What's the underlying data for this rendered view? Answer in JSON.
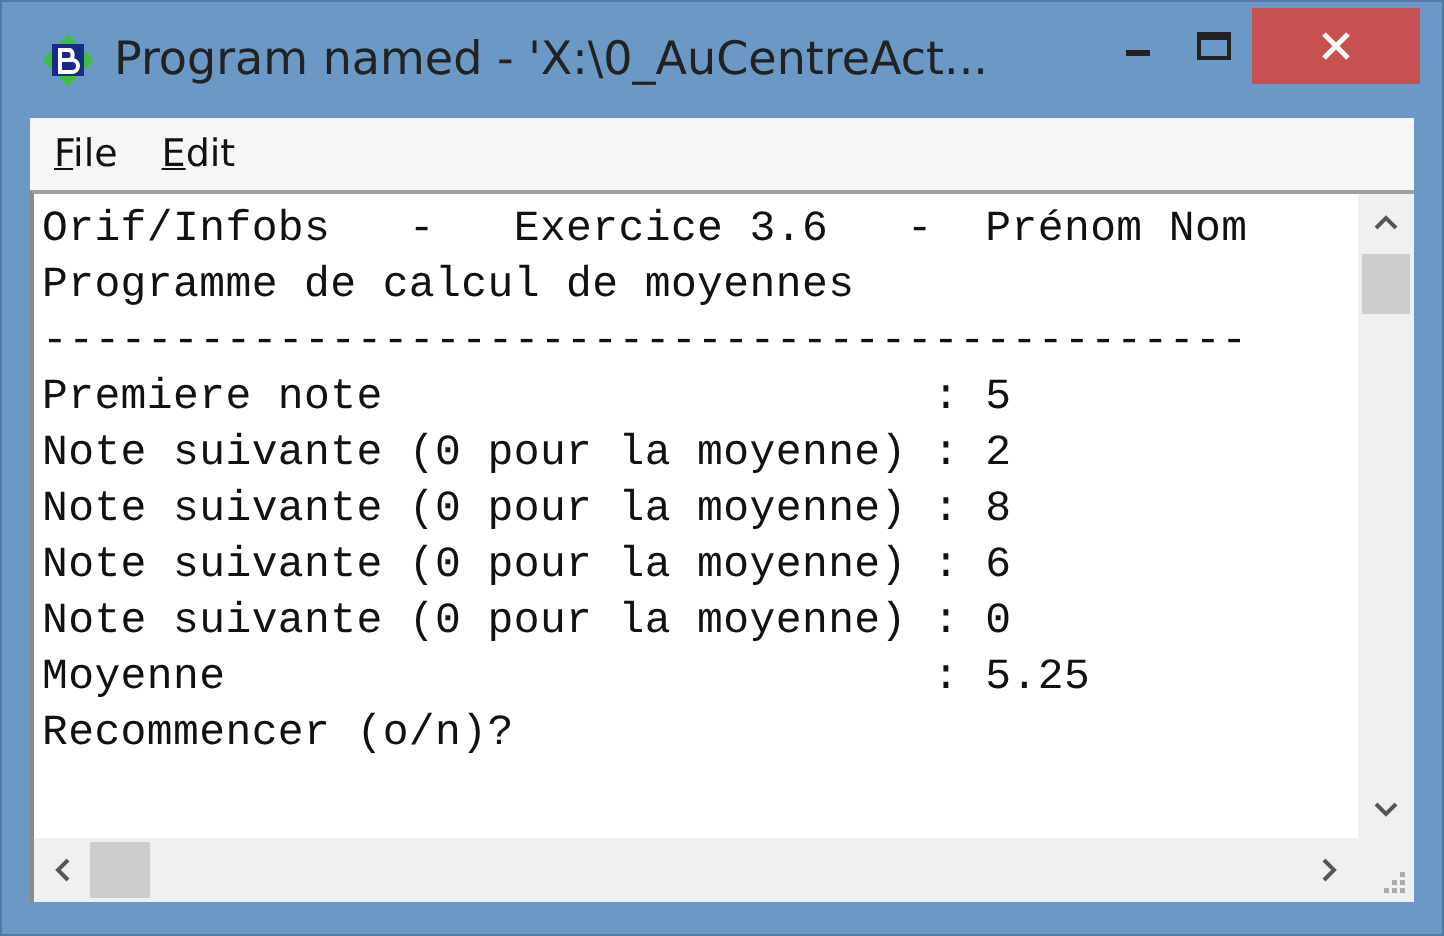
{
  "window": {
    "title": "Program named - 'X:\\0_AuCentreAct..."
  },
  "menu": [
    {
      "label": "File"
    },
    {
      "label": "Edit"
    }
  ],
  "console": {
    "lines": [
      "Orif/Infobs   -   Exercice 3.6   -  Prénom Nom",
      "Programme de calcul de moyennes",
      "----------------------------------------------",
      "Premiere note                     : 5",
      "Note suivante (0 pour la moyenne) : 2",
      "Note suivante (0 pour la moyenne) : 8",
      "Note suivante (0 pour la moyenne) : 6",
      "Note suivante (0 pour la moyenne) : 0",
      "Moyenne                           : 5.25",
      "Recommencer (o/n)?"
    ]
  }
}
